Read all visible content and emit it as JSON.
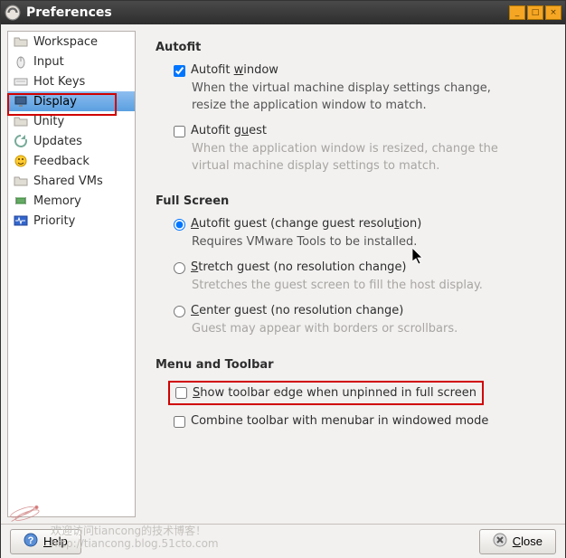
{
  "titlebar": {
    "title": "Preferences"
  },
  "sidebar": {
    "items": [
      {
        "label": "Workspace"
      },
      {
        "label": "Input"
      },
      {
        "label": "Hot Keys"
      },
      {
        "label": "Display"
      },
      {
        "label": "Unity"
      },
      {
        "label": "Updates"
      },
      {
        "label": "Feedback"
      },
      {
        "label": "Shared VMs"
      },
      {
        "label": "Memory"
      },
      {
        "label": "Priority"
      }
    ]
  },
  "sections": {
    "autofit": {
      "title": "Autofit",
      "autofit_window_label": "Autofit window",
      "autofit_window_help": "When the virtual machine display settings change, resize the application window to match.",
      "autofit_guest_label": "Autofit guest",
      "autofit_guest_help": "When the application window is resized, change the virtual machine display settings to match."
    },
    "fullscreen": {
      "title": "Full Screen",
      "opt_autofit_label": "Autofit guest (change guest resolution)",
      "opt_autofit_help": "Requires VMware Tools to be installed.",
      "opt_stretch_label": "Stretch guest (no resolution change)",
      "opt_stretch_help": "Stretches the guest screen to fill the host display.",
      "opt_center_label": "Center guest (no resolution change)",
      "opt_center_help": "Guest may appear with borders or scrollbars."
    },
    "menu": {
      "title": "Menu and Toolbar",
      "show_edge_label": "Show toolbar edge when unpinned in full screen",
      "combine_label": "Combine toolbar with menubar in windowed mode"
    }
  },
  "footer": {
    "help_label": "Help",
    "close_label": "Close"
  },
  "watermark": {
    "line1": "欢迎访问tiancong的技术博客！",
    "line2": "http://tiancong.blog.51cto.com"
  }
}
